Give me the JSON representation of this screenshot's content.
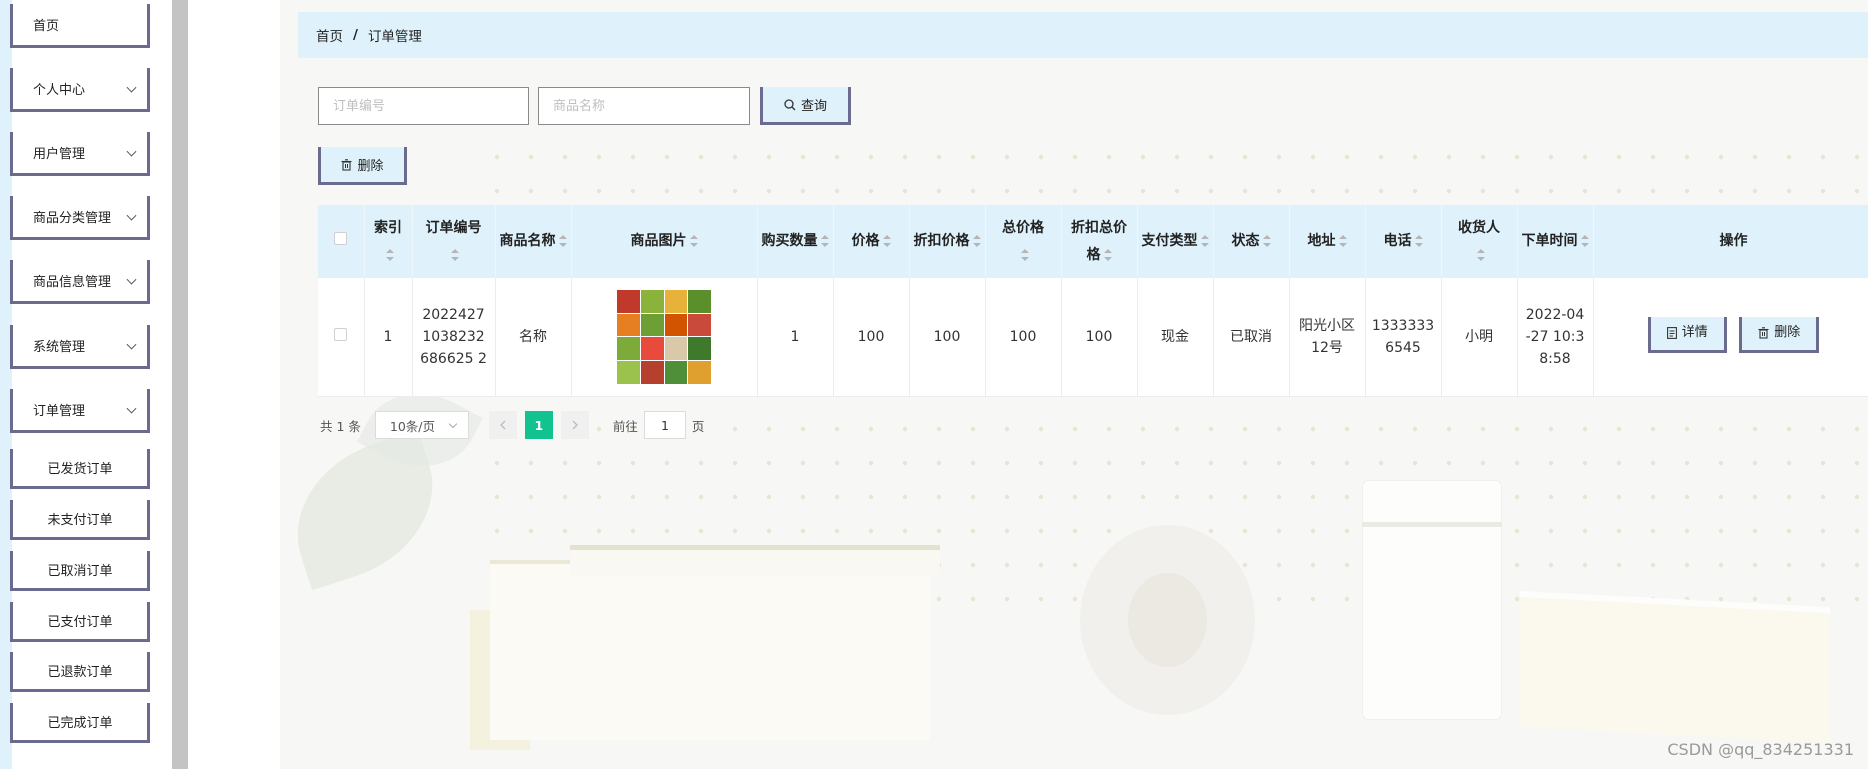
{
  "sidebar": {
    "menu": [
      {
        "label": "首页",
        "has_children": false
      },
      {
        "label": "个人中心",
        "has_children": true
      },
      {
        "label": "用户管理",
        "has_children": true
      },
      {
        "label": "商品分类管理",
        "has_children": true
      },
      {
        "label": "商品信息管理",
        "has_children": true
      },
      {
        "label": "系统管理",
        "has_children": true
      },
      {
        "label": "订单管理",
        "has_children": true
      }
    ],
    "order_submenu": [
      {
        "label": "已发货订单"
      },
      {
        "label": "未支付订单"
      },
      {
        "label": "已取消订单"
      },
      {
        "label": "已支付订单"
      },
      {
        "label": "已退款订单"
      },
      {
        "label": "已完成订单"
      }
    ]
  },
  "breadcrumb": {
    "home": "首页",
    "separator": "/",
    "current": "订单管理"
  },
  "search": {
    "order_no_placeholder": "订单编号",
    "product_name_placeholder": "商品名称",
    "query_label": "查询",
    "query_icon": "search-icon"
  },
  "toolbar": {
    "delete_label": "删除",
    "delete_icon": "trash-icon"
  },
  "table": {
    "columns": {
      "index": "索引",
      "order_no": "订单编号",
      "product_name": "商品名称",
      "product_image": "商品图片",
      "quantity": "购买数量",
      "price": "价格",
      "discount_price": "折扣价格",
      "total_price": "总价格",
      "discount_total": "折扣总价格",
      "pay_type": "支付类型",
      "status": "状态",
      "address": "地址",
      "phone": "电话",
      "receiver": "收货人",
      "order_time": "下单时间",
      "actions": "操作"
    },
    "rows": [
      {
        "index": "1",
        "order_no": "20224271038232686625 2",
        "product_name": "名称",
        "quantity": "1",
        "price": "100",
        "discount_price": "100",
        "total_price": "100",
        "discount_total": "100",
        "pay_type": "现金",
        "status": "已取消",
        "address": "阳光小区12号",
        "phone": "13333336545",
        "receiver": "小明",
        "order_time": "2022-04-27 10:38:58",
        "detail_label": "详情",
        "delete_label": "删除"
      }
    ]
  },
  "pagination": {
    "total": "共 1 条",
    "page_size": "10条/页",
    "current_page": "1",
    "goto_label": "前往",
    "goto_value": "1",
    "page_unit": "页"
  },
  "watermark": "CSDN @qq_834251331",
  "colors": {
    "accent_light_blue": "#dff2fb",
    "button_border": "#6b6b8f",
    "page_active": "#12c28f",
    "scrollbar_gray": "#c4c4c4"
  }
}
